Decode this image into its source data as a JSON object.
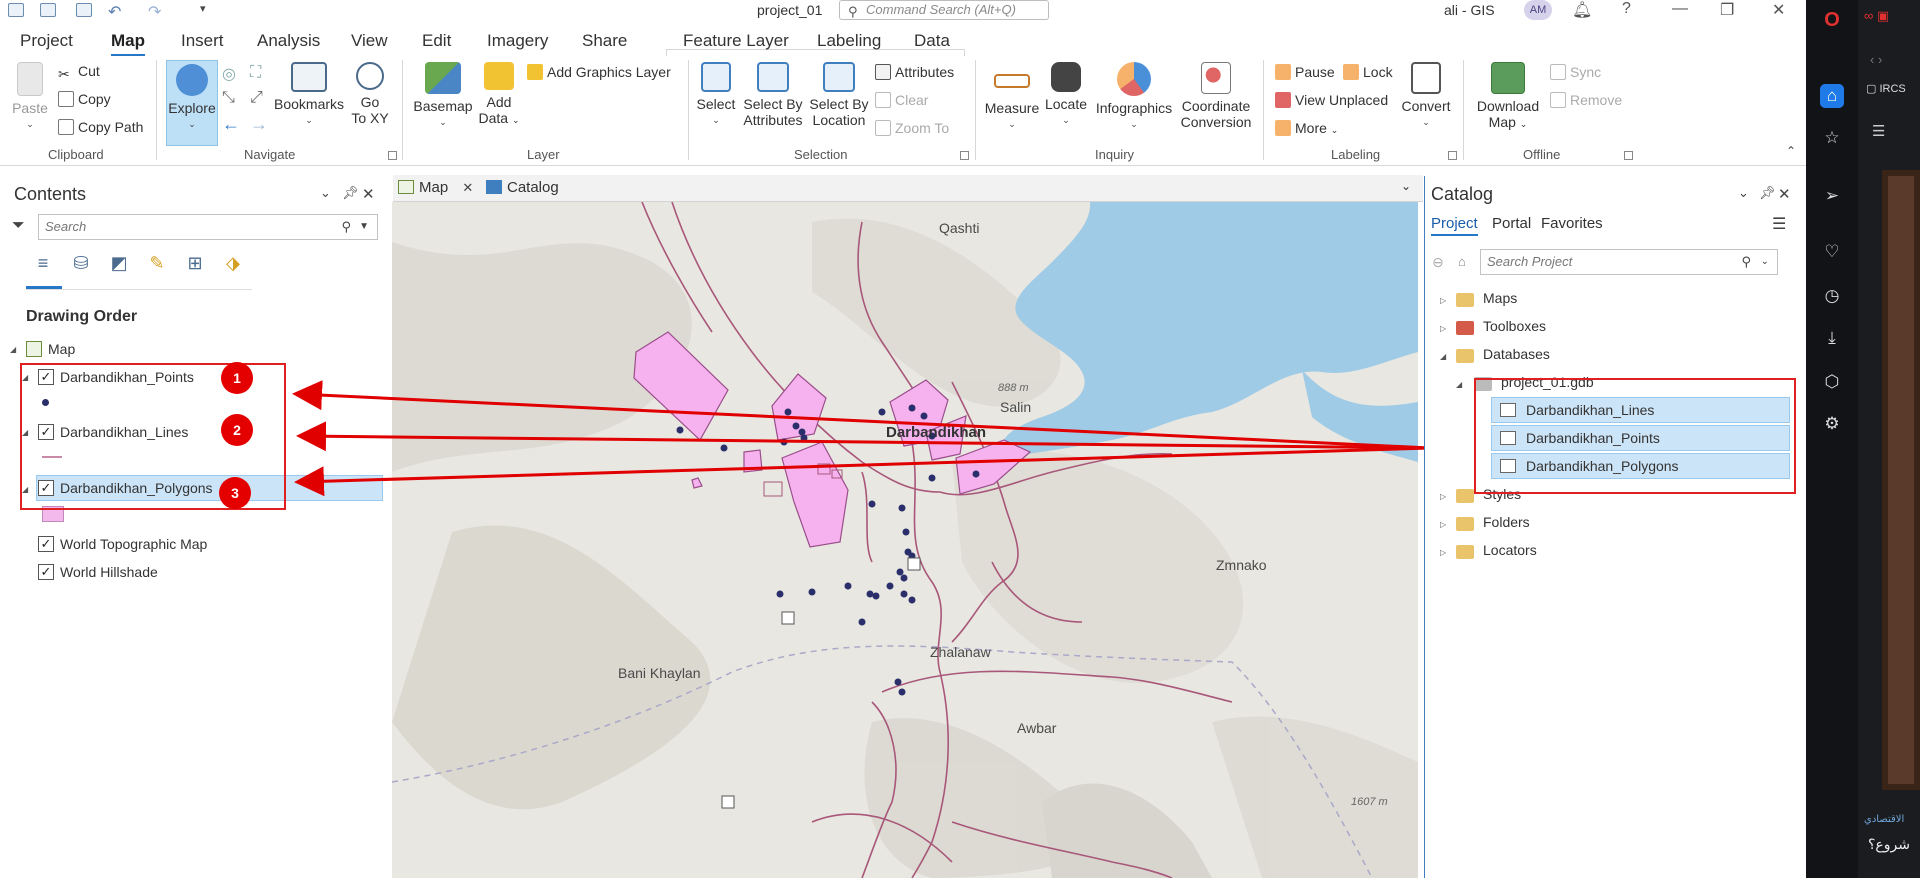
{
  "titlebar": {
    "project_name": "project_01",
    "command_search_placeholder": "Command Search (Alt+Q)",
    "user": "ali - GIS",
    "avatar_initials": "AM"
  },
  "menu_tabs": [
    "Project",
    "Map",
    "Insert",
    "Analysis",
    "View",
    "Edit",
    "Imagery",
    "Share"
  ],
  "context_tabs": [
    "Feature Layer",
    "Labeling",
    "Data"
  ],
  "active_tab": "Map",
  "ribbon": {
    "clipboard": {
      "label": "Clipboard",
      "paste": "Paste",
      "cut": "Cut",
      "copy": "Copy",
      "copy_path": "Copy Path"
    },
    "navigate": {
      "label": "Navigate",
      "explore": "Explore",
      "bookmarks": "Bookmarks",
      "goto_xy_1": "Go",
      "goto_xy_2": "To XY"
    },
    "layer": {
      "label": "Layer",
      "basemap": "Basemap",
      "add_data_1": "Add",
      "add_data_2": "Data",
      "add_graphics": "Add Graphics Layer"
    },
    "selection": {
      "label": "Selection",
      "select": "Select",
      "select_by_attr_1": "Select By",
      "select_by_attr_2": "Attributes",
      "select_by_loc_1": "Select By",
      "select_by_loc_2": "Location",
      "attributes": "Attributes",
      "clear": "Clear",
      "zoom_to": "Zoom To"
    },
    "inquiry": {
      "label": "Inquiry",
      "measure": "Measure",
      "locate": "Locate",
      "infographics": "Infographics",
      "coord_1": "Coordinate",
      "coord_2": "Conversion"
    },
    "labeling": {
      "label": "Labeling",
      "pause": "Pause",
      "lock": "Lock",
      "view_unplaced": "View Unplaced",
      "more": "More",
      "convert": "Convert"
    },
    "offline": {
      "label": "Offline",
      "download_1": "Download",
      "download_2": "Map",
      "sync": "Sync",
      "remove": "Remove"
    }
  },
  "contents": {
    "title": "Contents",
    "search_placeholder": "Search",
    "heading": "Drawing Order",
    "map_node": "Map",
    "layers": [
      {
        "name": "Darbandikhan_Points",
        "checked": true
      },
      {
        "name": "Darbandikhan_Lines",
        "checked": true
      },
      {
        "name": "Darbandikhan_Polygons",
        "checked": true,
        "selected": true
      },
      {
        "name": "World Topographic Map",
        "checked": true
      },
      {
        "name": "World Hillshade",
        "checked": true
      }
    ],
    "badges": [
      "1",
      "2",
      "3"
    ]
  },
  "view_tabs": [
    {
      "label": "Map",
      "icon": "map-icon"
    },
    {
      "label": "Catalog",
      "icon": "catalog-icon"
    }
  ],
  "map": {
    "labels": [
      "Qashti",
      "Darbandikhan",
      "Zmnako",
      "Bani Khaylan",
      "Zhalanaw",
      "Awbar",
      "Salin"
    ],
    "elevations": [
      "888 m",
      "1607 m"
    ],
    "colors": {
      "water": "#9fcbe6",
      "terrain": "#e9e7e1",
      "road": "#a8577a",
      "polygon": "#f6b2ee",
      "point": "#2a2f6b",
      "arrow": "#e00000"
    }
  },
  "catalog": {
    "title": "Catalog",
    "tabs": [
      "Project",
      "Portal",
      "Favorites"
    ],
    "active_tab": "Project",
    "search_placeholder": "Search Project",
    "items": [
      "Maps",
      "Toolboxes",
      "Databases",
      "Styles",
      "Folders",
      "Locators"
    ],
    "gdb": "project_01.gdb",
    "gdb_items": [
      "Darbandikhan_Lines",
      "Darbandikhan_Points",
      "Darbandikhan_Polygons"
    ]
  },
  "browser": {
    "tab_label": "IRCS",
    "rtl_text_1": "الاقتصادي",
    "rtl_text_2": "شروع؟"
  }
}
